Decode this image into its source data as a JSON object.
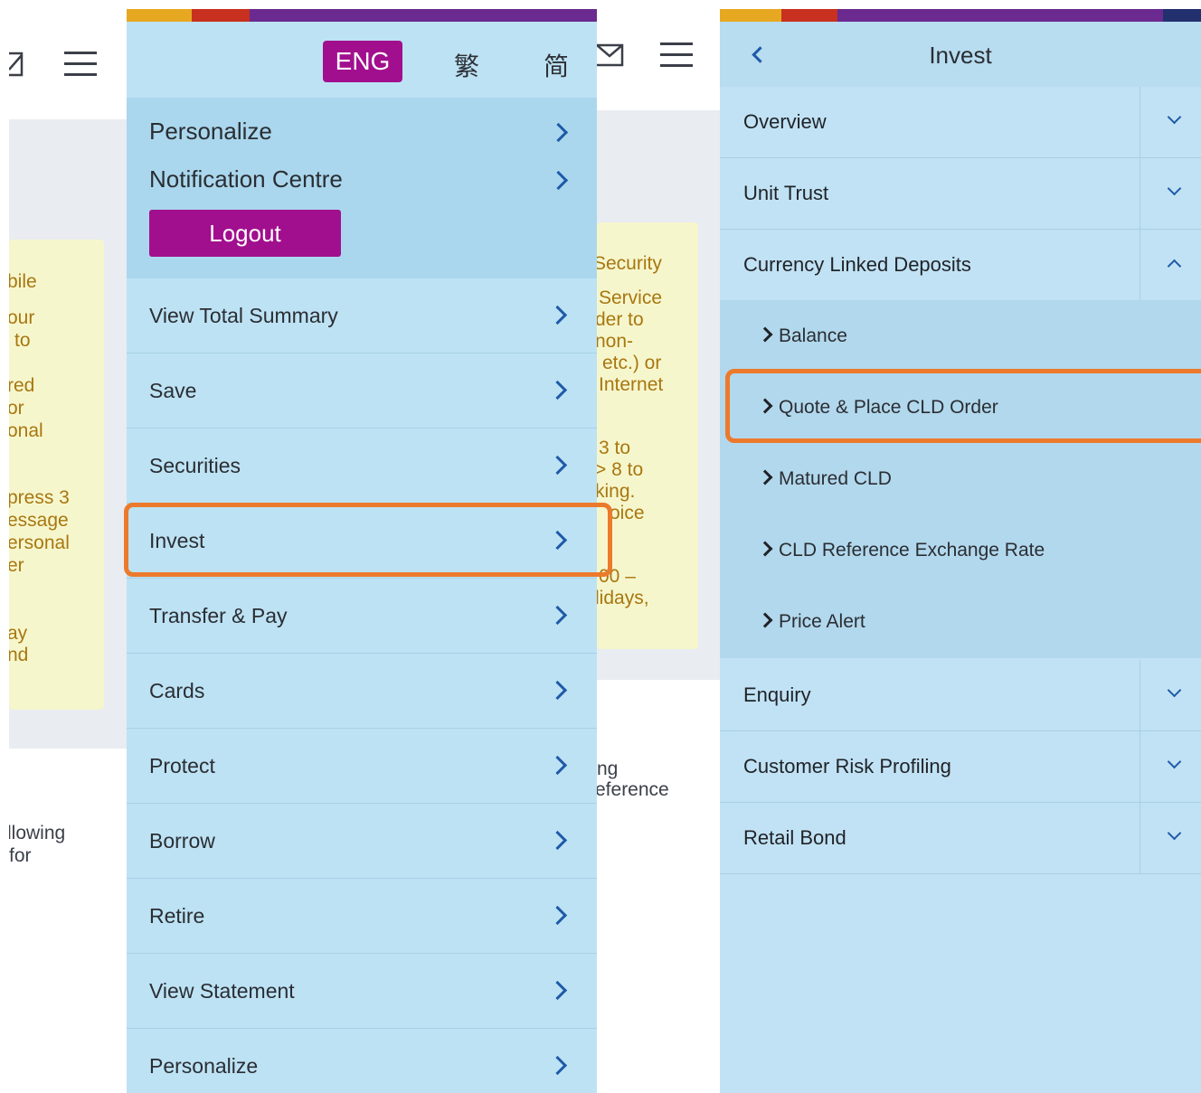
{
  "left_page": {
    "notice_fragments": [
      "bile",
      "our",
      "to",
      "red",
      "or",
      "onal",
      "press 3",
      "essage",
      "ersonal",
      "er",
      "ay",
      "nd"
    ],
    "body_fragments": [
      "llowing",
      "for"
    ]
  },
  "mid_page": {
    "notice_fragments": [
      "Security",
      "Service",
      "der to",
      "non-",
      "etc.) or",
      "Internet",
      "3 to",
      "> 8 to",
      "king.",
      "oice",
      "00 –",
      "lidays,"
    ],
    "body_fragments": [
      "ng",
      "eference"
    ]
  },
  "menu": {
    "languages": {
      "selected": "ENG",
      "traditional": "繁",
      "simplified": "简"
    },
    "personal": [
      {
        "label": "Personalize"
      },
      {
        "label": "Notification Centre"
      }
    ],
    "logout_label": "Logout",
    "items": [
      {
        "label": "View Total Summary"
      },
      {
        "label": "Save"
      },
      {
        "label": "Securities"
      },
      {
        "label": "Invest"
      },
      {
        "label": "Transfer & Pay"
      },
      {
        "label": "Cards"
      },
      {
        "label": "Protect"
      },
      {
        "label": "Borrow"
      },
      {
        "label": "Retire"
      },
      {
        "label": "View Statement"
      },
      {
        "label": "Personalize"
      }
    ]
  },
  "invest": {
    "title": "Invest",
    "sections": [
      {
        "label": "Overview"
      },
      {
        "label": "Unit Trust"
      },
      {
        "label": "Currency Linked Deposits"
      },
      {
        "label": "Enquiry"
      },
      {
        "label": "Customer Risk Profiling"
      },
      {
        "label": "Retail Bond"
      }
    ],
    "cld_items": [
      {
        "label": "Balance"
      },
      {
        "label": "Quote & Place CLD Order"
      },
      {
        "label": "Matured CLD"
      },
      {
        "label": "CLD Reference Exchange Rate"
      },
      {
        "label": "Price Alert"
      }
    ]
  },
  "colors": {
    "brand_purple": "#a10f8e",
    "menu_bg": "#bde2f4",
    "highlight_orange": "#ec7a2c",
    "notice_text": "#a8770f",
    "chevron_blue": "#1f5aa8"
  }
}
